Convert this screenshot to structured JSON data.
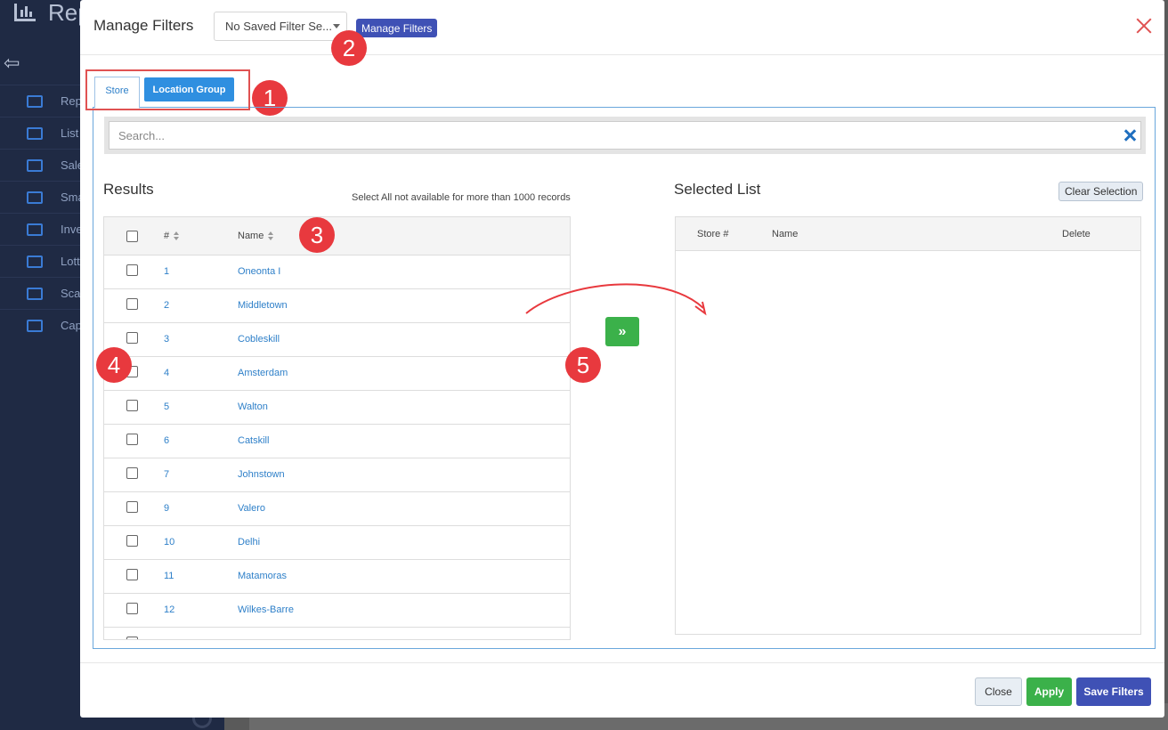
{
  "background": {
    "app_title": "Rep",
    "sidebar_items": [
      "Rep",
      "List",
      "Sale",
      "Sma",
      "Inve",
      "Lotte",
      "Sca",
      "Cap"
    ]
  },
  "modal": {
    "title": "Manage Filters",
    "saved_filter_select": "No Saved Filter Se...",
    "manage_filters_button": "Manage Filters",
    "tabs": [
      "Store",
      "Location Group"
    ],
    "search_placeholder": "Search...",
    "results": {
      "heading": "Results",
      "note": "Select All not available for more than 1000 records",
      "columns": [
        "#",
        "Name"
      ],
      "rows": [
        {
          "num": "1",
          "name": "Oneonta I"
        },
        {
          "num": "2",
          "name": "Middletown"
        },
        {
          "num": "3",
          "name": "Cobleskill"
        },
        {
          "num": "4",
          "name": "Amsterdam"
        },
        {
          "num": "5",
          "name": "Walton"
        },
        {
          "num": "6",
          "name": "Catskill"
        },
        {
          "num": "7",
          "name": "Johnstown"
        },
        {
          "num": "9",
          "name": "Valero"
        },
        {
          "num": "10",
          "name": "Delhi"
        },
        {
          "num": "11",
          "name": "Matamoras"
        },
        {
          "num": "12",
          "name": "Wilkes-Barre"
        }
      ]
    },
    "move_button_glyph": "»",
    "selected": {
      "heading": "Selected List",
      "clear_button": "Clear Selection",
      "columns": [
        "Store #",
        "Name",
        "Delete"
      ]
    },
    "footer": {
      "close": "Close",
      "apply": "Apply",
      "save": "Save Filters"
    }
  },
  "annotations": [
    "1",
    "2",
    "3",
    "4",
    "5"
  ],
  "colors": {
    "primary_blue": "#3f51b5",
    "tab_blue": "#2f8fe0",
    "green": "#3bb14a",
    "annotation_red": "#e8393e",
    "link_blue": "#2f80c9"
  }
}
